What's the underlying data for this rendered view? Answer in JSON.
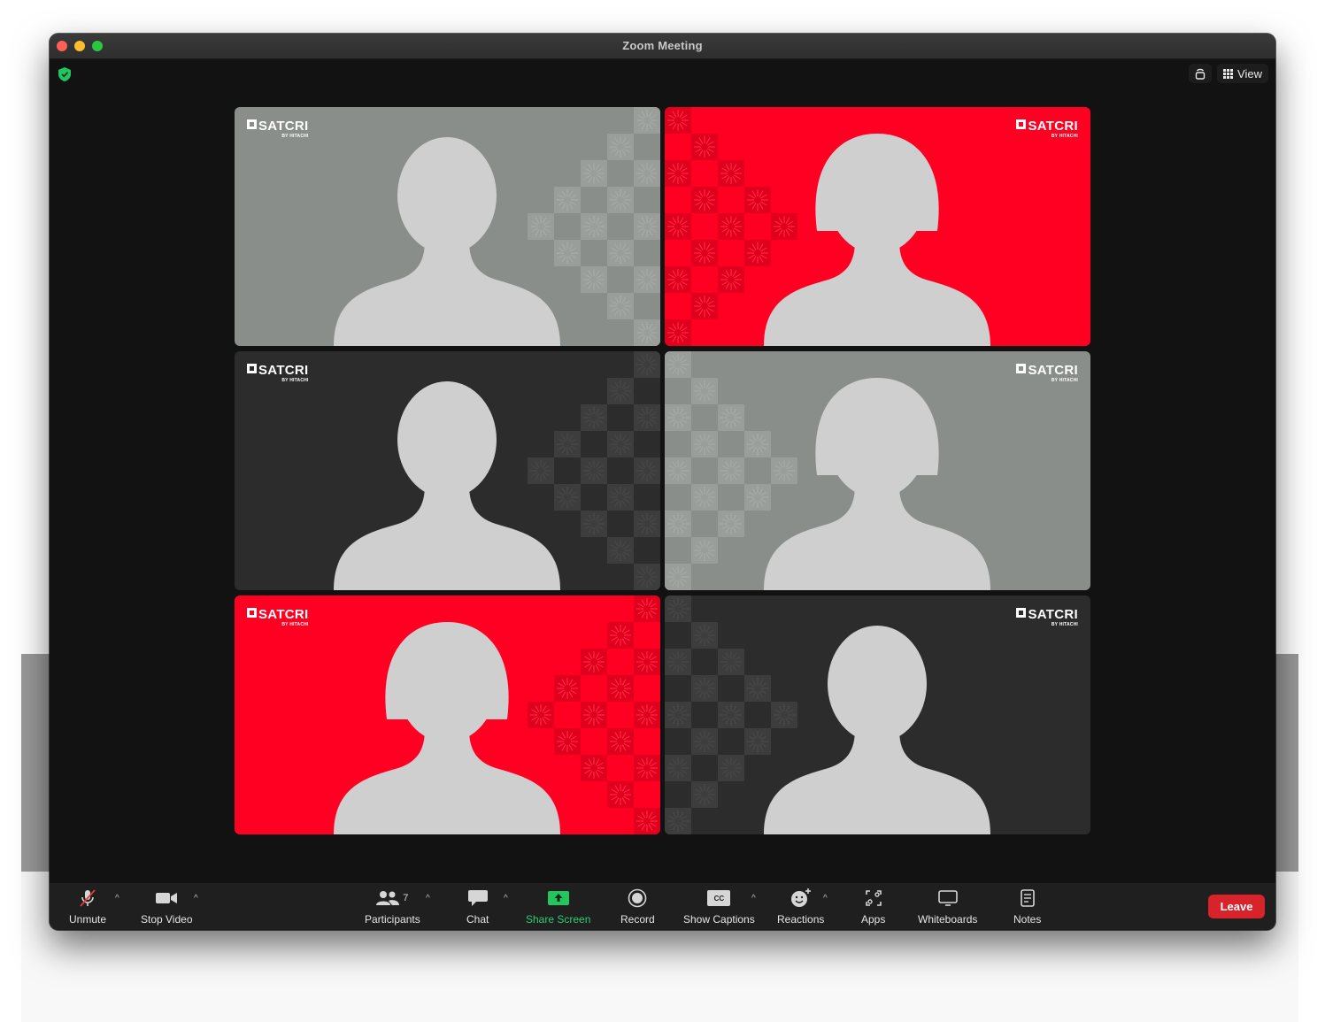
{
  "window": {
    "title": "Zoom Meeting"
  },
  "top_right": {
    "view_label": "View"
  },
  "tiles": [
    {
      "bg": "#8a8e8b",
      "logo_side": "left",
      "logo_text": "SATCRI",
      "logo_sub": "BY HITACHI"
    },
    {
      "bg": "#ff0022",
      "logo_side": "right",
      "logo_text": "SATCRI",
      "logo_sub": "BY HITACHI"
    },
    {
      "bg": "#2c2c2c",
      "logo_side": "left",
      "logo_text": "SATCRI",
      "logo_sub": "BY HITACHI"
    },
    {
      "bg": "#8a8e8b",
      "logo_side": "right",
      "logo_text": "SATCRI",
      "logo_sub": "BY HITACHI"
    },
    {
      "bg": "#ff0022",
      "logo_side": "left",
      "logo_text": "SATCRI",
      "logo_sub": "BY HITACHI"
    },
    {
      "bg": "#2c2c2c",
      "logo_side": "right",
      "logo_text": "SATCRI",
      "logo_sub": "BY HITACHI"
    }
  ],
  "toolbar": {
    "unmute": "Unmute",
    "stop_video": "Stop Video",
    "participants": "Participants",
    "participant_count": "7",
    "chat": "Chat",
    "share_screen": "Share Screen",
    "record": "Record",
    "show_captions": "Show Captions",
    "captions_badge": "CC",
    "reactions": "Reactions",
    "apps": "Apps",
    "whiteboards": "Whiteboards",
    "notes": "Notes",
    "leave": "Leave"
  },
  "colors": {
    "accent_green": "#2ecc71",
    "leave_red": "#d8232a",
    "silhouette": "#cfcfcf"
  }
}
